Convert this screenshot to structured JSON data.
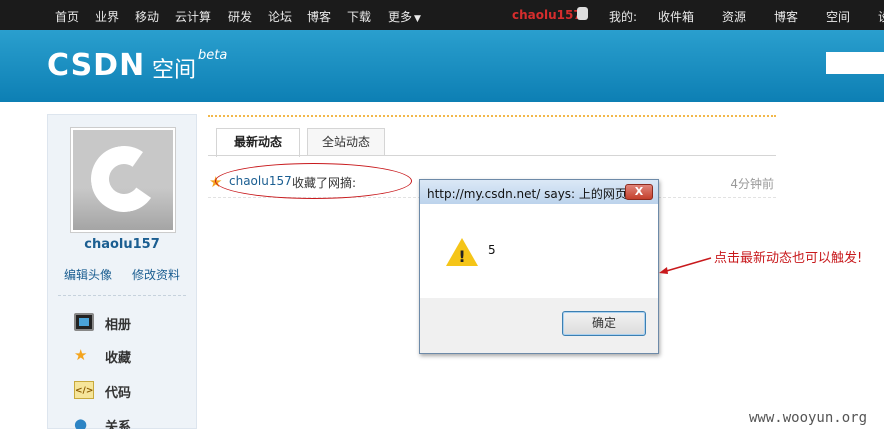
{
  "topnav": {
    "items": [
      "首页",
      "业界",
      "移动",
      "云计算",
      "研发",
      "论坛",
      "博客",
      "下载"
    ],
    "more_label": "更多",
    "user": "chaolu157",
    "my_label": "我的:",
    "right_items": [
      "收件箱",
      "资源",
      "博客",
      "空间"
    ],
    "edge_char": "设"
  },
  "banner": {
    "logo": "CSDN",
    "logo_sub": "空间",
    "logo_beta": "beta"
  },
  "sidebar": {
    "username": "chaolu157",
    "links": [
      "编辑头像",
      "修改资料"
    ],
    "menu": [
      {
        "label": "相册",
        "icon": "album-icon"
      },
      {
        "label": "收藏",
        "icon": "star-icon"
      },
      {
        "label": "代码",
        "icon": "code-icon"
      },
      {
        "label": "关系",
        "icon": "relation-icon"
      }
    ]
  },
  "tabs": [
    {
      "label": "最新动态",
      "active": true
    },
    {
      "label": "全站动态",
      "active": false
    }
  ],
  "activity": {
    "user": "chaolu157",
    "action": "收藏了网摘:",
    "time": "4分钟前"
  },
  "dialog": {
    "title": "http://my.csdn.net/ says: 上的网页",
    "close": "X",
    "message": "5",
    "ok": "确定"
  },
  "annotation": {
    "note": "点击最新动态也可以触发!",
    "color": "#c8191c"
  },
  "watermark": "www.wooyun.org"
}
